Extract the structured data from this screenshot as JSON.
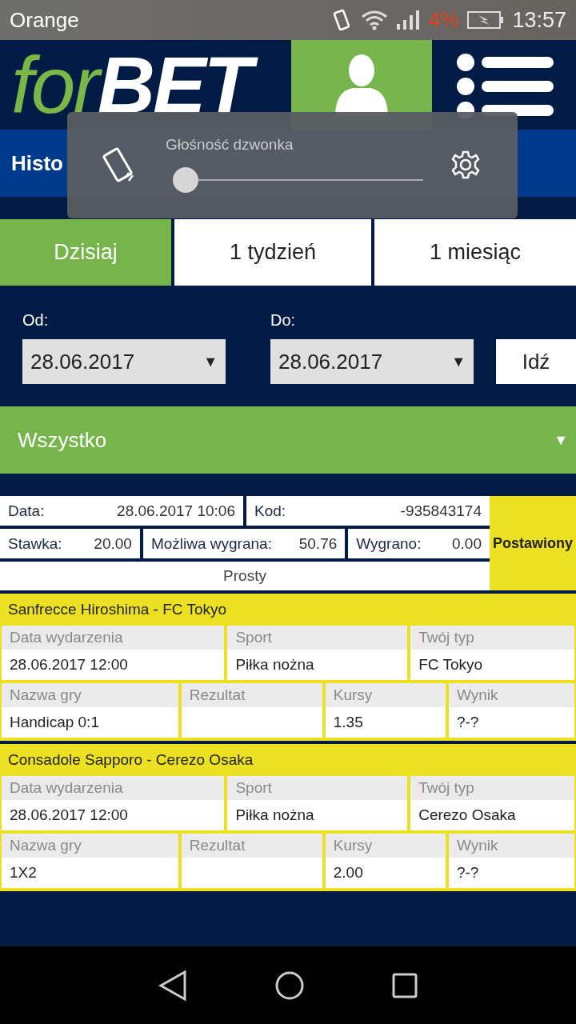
{
  "status_bar": {
    "carrier": "Orange",
    "battery": "4%",
    "time": "13:57"
  },
  "header": {
    "logo_prefix": "for",
    "logo_suffix": "BET"
  },
  "page_title": "Histo",
  "volume_panel": {
    "title": "Głośność dzwonka",
    "level": 0
  },
  "tabs": [
    {
      "label": "Dzisiaj",
      "selected": true
    },
    {
      "label": "1 tydzień",
      "selected": false
    },
    {
      "label": "1 miesiąc",
      "selected": false
    }
  ],
  "date_from": {
    "label": "Od:",
    "value": "28.06.2017",
    "arrow": "▼"
  },
  "date_to": {
    "label": "Do:",
    "value": "28.06.2017",
    "arrow": "▼"
  },
  "go_button": "Idź",
  "filter": {
    "value": "Wszystko",
    "arrow": "▼"
  },
  "coupon": {
    "rows": [
      [
        {
          "label": "Data:",
          "value": "28.06.2017 10:06"
        },
        {
          "label": "Kod:",
          "value": "-935843174"
        }
      ],
      [
        {
          "label": "Stawka:",
          "value": "20.00"
        },
        {
          "label": "Możliwa wygrana:",
          "value": "50.76"
        },
        {
          "label": "Wygrano:",
          "value": "0.00"
        }
      ]
    ],
    "type": "Prosty",
    "status": "Postawiony"
  },
  "events": [
    {
      "title": "Sanfrecce Hiroshima - FC Tokyo",
      "groups": [
        {
          "fields": [
            {
              "label": "Data wydarzenia",
              "value": "28.06.2017 12:00"
            },
            {
              "label": "Sport",
              "value": "Piłka nożna"
            },
            {
              "label": "Twój typ",
              "value": "FC Tokyo"
            }
          ]
        },
        {
          "fields": [
            {
              "label": "Nazwa gry",
              "value": "Handicap 0:1"
            },
            {
              "label": "Rezultat"
            },
            {
              "label": "Kursy",
              "value": "1.35"
            },
            {
              "label": "Wynik",
              "value": "?-?"
            }
          ]
        }
      ]
    },
    {
      "title": "Consadole Sapporo - Cerezo Osaka",
      "groups": [
        {
          "fields": [
            {
              "label": "Data wydarzenia",
              "value": "28.06.2017 12:00"
            },
            {
              "label": "Sport",
              "value": "Piłka nożna"
            },
            {
              "label": "Twój typ",
              "value": "Cerezo Osaka"
            }
          ]
        },
        {
          "fields": [
            {
              "label": "Nazwa gry",
              "value": "1X2"
            },
            {
              "label": "Rezultat"
            },
            {
              "label": "Kursy",
              "value": "2.00"
            },
            {
              "label": "Wynik",
              "value": "?-?"
            }
          ]
        }
      ]
    }
  ]
}
